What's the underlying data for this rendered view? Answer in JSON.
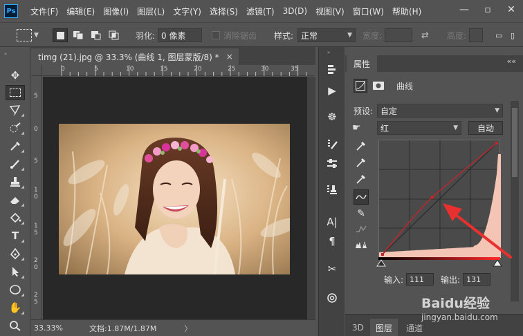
{
  "app": {
    "logo": "Ps"
  },
  "menu": [
    "文件(F)",
    "编辑(E)",
    "图像(I)",
    "图层(L)",
    "文字(Y)",
    "选择(S)",
    "滤镜(T)",
    "3D(D)",
    "视图(V)",
    "窗口(W)",
    "帮助(H)"
  ],
  "window_controls": {
    "minimize": "—",
    "restore": "▫",
    "close": "✕"
  },
  "options": {
    "feather_label": "羽化:",
    "feather_value": "0 像素",
    "antialias_label": "消除锯齿",
    "style_label": "样式:",
    "style_value": "正常",
    "width_label": "宽度:",
    "height_label": "高度:"
  },
  "document": {
    "tab_title": "timg (21).jpg @ 33.3% (曲线 1, 图层蒙版/8) *",
    "close": "×",
    "ruler_h": [
      "0",
      "5",
      "10",
      "15",
      "20",
      "25",
      "30",
      "35"
    ],
    "ruler_v": [
      "5",
      "0",
      "5",
      "1",
      "0",
      "1",
      "5",
      "2",
      "0",
      "2",
      "5"
    ],
    "zoom": "33.33%",
    "doc_info": "文档:1.87M/1.87M",
    "status_caret": "〉"
  },
  "properties": {
    "tab": "属性",
    "collapse": "««",
    "adjustment_name": "曲线",
    "preset_label": "预设:",
    "preset_value": "自定",
    "channel_value": "红",
    "auto_button": "自动",
    "input_label": "输入:",
    "input_value": "111",
    "output_label": "输出:",
    "output_value": "131"
  },
  "layers_tabs": [
    "3D",
    "图层",
    "通道"
  ],
  "watermark": {
    "logo_text": "Baidu经验",
    "url": "jingyan.baidu.com"
  },
  "colors": {
    "bg": "#535353",
    "dark_panel": "#424242",
    "canvas_bg": "#282828",
    "curve_line": "#c0262c",
    "histogram_fill": "#f4c4b4",
    "arrow": "#e8302e"
  }
}
